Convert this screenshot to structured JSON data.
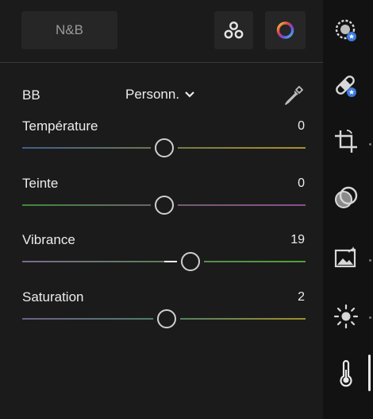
{
  "header": {
    "bw_label": "N&B",
    "mix_icon": "color-mixer-icon",
    "color_grading_icon": "color-wheel-icon"
  },
  "white_balance": {
    "label": "BB",
    "preset": "Personn.",
    "eyedropper_icon": "eyedropper-icon"
  },
  "sliders": [
    {
      "label": "Température",
      "value": "0",
      "position": 0.5
    },
    {
      "label": "Teinte",
      "value": "0",
      "position": 0.5
    },
    {
      "label": "Vibrance",
      "value": "19",
      "position": 0.595
    },
    {
      "label": "Saturation",
      "value": "2",
      "position": 0.51
    }
  ],
  "rail": {
    "items": [
      {
        "icon": "auto-presets-icon"
      },
      {
        "icon": "healing-bandage-icon"
      },
      {
        "icon": "crop-icon"
      },
      {
        "icon": "masking-icon"
      },
      {
        "icon": "effects-image-icon"
      },
      {
        "icon": "light-sun-icon"
      },
      {
        "icon": "color-thermometer-icon",
        "active": true
      }
    ]
  },
  "colors": {
    "temp_gradient": [
      "#3e5f8a",
      "#6f7a4c",
      "#a8902a"
    ],
    "tint_gradient": [
      "#3f8a3b",
      "#6f5f6f",
      "#8a4f8a"
    ],
    "vibrance_gradient": [
      "#7b6a8e",
      "#5b7f5a",
      "#4fa236"
    ],
    "saturation_gradient": [
      "#6c5f86",
      "#4d7f6a",
      "#a08e2a"
    ],
    "accent": "#e8e8e8"
  }
}
